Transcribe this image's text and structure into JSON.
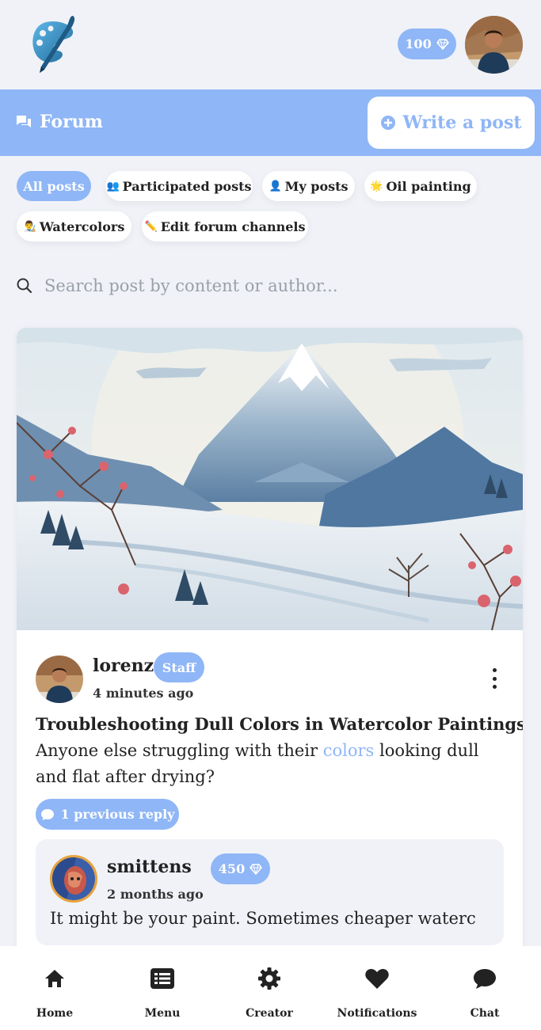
{
  "header": {
    "gems": "100",
    "logo_name": "palette-brush-logo",
    "avatar_desc": "user-avatar"
  },
  "forum": {
    "title": "Forum",
    "write_label": "Write a post"
  },
  "filters": [
    {
      "label": "All posts",
      "emoji": "",
      "active": true
    },
    {
      "label": "Participated posts",
      "emoji": "👥",
      "active": false
    },
    {
      "label": "My posts",
      "emoji": "👤",
      "active": false
    },
    {
      "label": "Oil painting",
      "emoji": "🌟",
      "active": false
    },
    {
      "label": "Watercolors",
      "emoji": "👨‍🎨",
      "active": false
    },
    {
      "label": "Edit forum channels",
      "emoji": "✏️",
      "active": false
    }
  ],
  "search": {
    "placeholder": "Search post by content or author..."
  },
  "post": {
    "author": "lorenz",
    "badge": "Staff",
    "time": "4 minutes ago",
    "title": "Troubleshooting Dull Colors in Watercolor Paintings",
    "body_before": "Anyone else struggling with their ",
    "body_link": "colors",
    "body_after": " looking dull and flat after drying?",
    "reply_count_label": "1 previous reply",
    "reply": {
      "author": "smittens",
      "gems": "450",
      "time": "2 months ago",
      "text": "It might be your paint. Sometimes cheaper waterc"
    }
  },
  "nav": [
    {
      "label": "Home",
      "icon": "home-icon"
    },
    {
      "label": "Menu",
      "icon": "menu-list-icon"
    },
    {
      "label": "Creator",
      "icon": "gear-icon"
    },
    {
      "label": "Notifications",
      "icon": "heart-icon"
    },
    {
      "label": "Chat",
      "icon": "chat-icon"
    }
  ],
  "colors": {
    "accent": "#8fb6f6",
    "background": "#f0f2f8"
  }
}
